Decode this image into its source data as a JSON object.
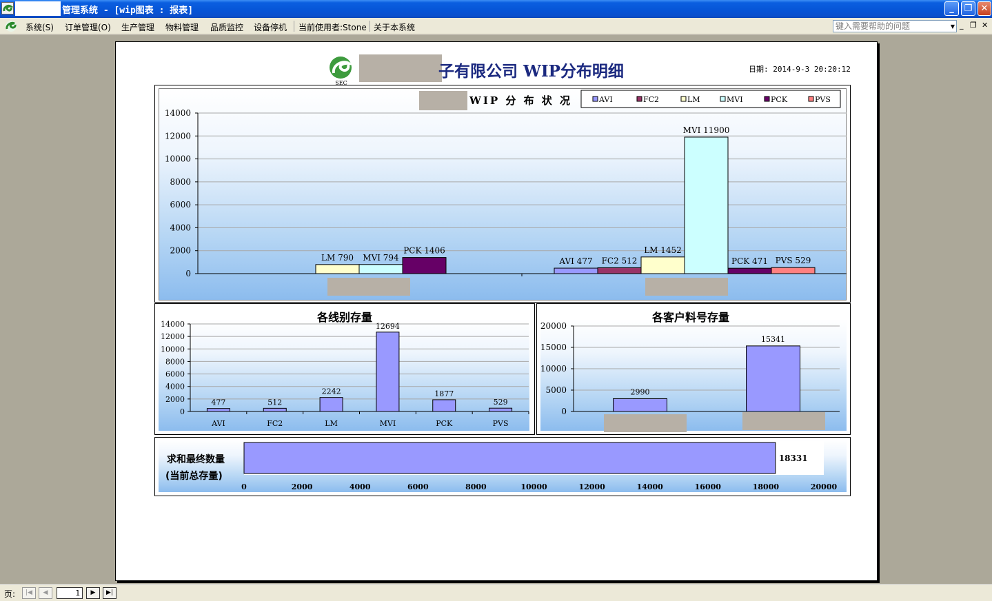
{
  "window": {
    "title": "管理系统 - [wip图表 : 报表]",
    "minimize": "_",
    "restore": "❐",
    "close": "✕"
  },
  "menu": {
    "items": [
      "系统(S)",
      "订单管理(O)",
      "生产管理",
      "物料管理",
      "品质监控",
      "设备停机"
    ],
    "current_user": "当前使用者:Stone",
    "about": "关于本系统",
    "help_placeholder": "键入需要帮助的问题"
  },
  "report": {
    "title": "子有限公司 WIP分布明细",
    "date": "日期: 2014-9-3 20:20:12",
    "logo_text": "SEC"
  },
  "colors": {
    "AVI": "#9999ff",
    "FC2": "#993366",
    "LM": "#ffffcc",
    "MVI": "#ccffff",
    "PCK": "#660066",
    "PVS": "#ff8080",
    "bar": "#9999ff"
  },
  "chart_data": [
    {
      "type": "bar",
      "title": "WIP 分 布 状 况",
      "legend": [
        "AVI",
        "FC2",
        "LM",
        "MVI",
        "PCK",
        "PVS"
      ],
      "legend_position": "top-right",
      "ylim": [
        0,
        14000
      ],
      "yticks": [
        0,
        2000,
        4000,
        6000,
        8000,
        10000,
        12000,
        14000
      ],
      "grid": true,
      "groups": [
        {
          "category": "",
          "bars": [
            {
              "series": "LM",
              "value": 790,
              "label": "LM 790"
            },
            {
              "series": "MVI",
              "value": 794,
              "label": "MVI 794"
            },
            {
              "series": "PCK",
              "value": 1406,
              "label": "PCK 1406"
            }
          ]
        },
        {
          "category": "",
          "bars": [
            {
              "series": "AVI",
              "value": 477,
              "label": "AVI 477"
            },
            {
              "series": "FC2",
              "value": 512,
              "label": "FC2 512"
            },
            {
              "series": "LM",
              "value": 1452,
              "label": "LM 1452"
            },
            {
              "series": "MVI",
              "value": 11900,
              "label": "MVI 11900"
            },
            {
              "series": "PCK",
              "value": 471,
              "label": "PCK 471"
            },
            {
              "series": "PVS",
              "value": 529,
              "label": "PVS 529"
            }
          ]
        }
      ]
    },
    {
      "type": "bar",
      "title": "各线别存量",
      "categories": [
        "AVI",
        "FC2",
        "LM",
        "MVI",
        "PCK",
        "PVS"
      ],
      "values": [
        477,
        512,
        2242,
        12694,
        1877,
        529
      ],
      "ylim": [
        0,
        14000
      ],
      "yticks": [
        0,
        2000,
        4000,
        6000,
        8000,
        10000,
        12000,
        14000
      ],
      "grid": true
    },
    {
      "type": "bar",
      "title": "各客户料号存量",
      "categories": [
        "",
        ""
      ],
      "values": [
        2990,
        15341
      ],
      "ylim": [
        0,
        20000
      ],
      "yticks": [
        0,
        5000,
        10000,
        15000,
        20000
      ],
      "grid": true
    },
    {
      "type": "bar",
      "orientation": "horizontal",
      "title": "求和最终数量",
      "subtitle": "(当前总存量)",
      "values": [
        18331
      ],
      "xlim": [
        0,
        20000
      ],
      "xticks": [
        0,
        2000,
        4000,
        6000,
        8000,
        10000,
        12000,
        14000,
        16000,
        18000,
        20000
      ]
    }
  ],
  "pager": {
    "label": "页:",
    "page": "1",
    "first": "|◀",
    "prev": "◀",
    "next": "▶",
    "last": "▶|"
  }
}
